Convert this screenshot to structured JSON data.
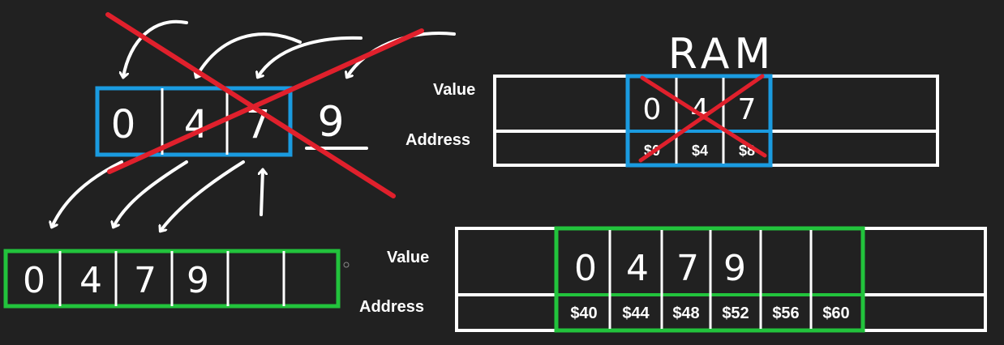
{
  "top_array": {
    "values": [
      "0",
      "4",
      "7"
    ],
    "appended": "9"
  },
  "new_array": {
    "values": [
      "0",
      "4",
      "7",
      "9",
      "",
      ""
    ]
  },
  "ram_top": {
    "title": "RAM",
    "value_label": "Value",
    "address_label": "Address",
    "values": [
      "0",
      "4",
      "7"
    ],
    "addresses": [
      "$0",
      "$4",
      "$8"
    ]
  },
  "ram_bottom": {
    "value_label": "Value",
    "address_label": "Address",
    "values": [
      "0",
      "4",
      "7",
      "9",
      "",
      ""
    ],
    "addresses": [
      "$40",
      "$44",
      "$48",
      "$52",
      "$56",
      "$60"
    ]
  },
  "colors": {
    "background": "#212121",
    "blue": "#1a9be0",
    "green": "#22c33c",
    "red": "#e0202c",
    "white": "#ffffff"
  }
}
